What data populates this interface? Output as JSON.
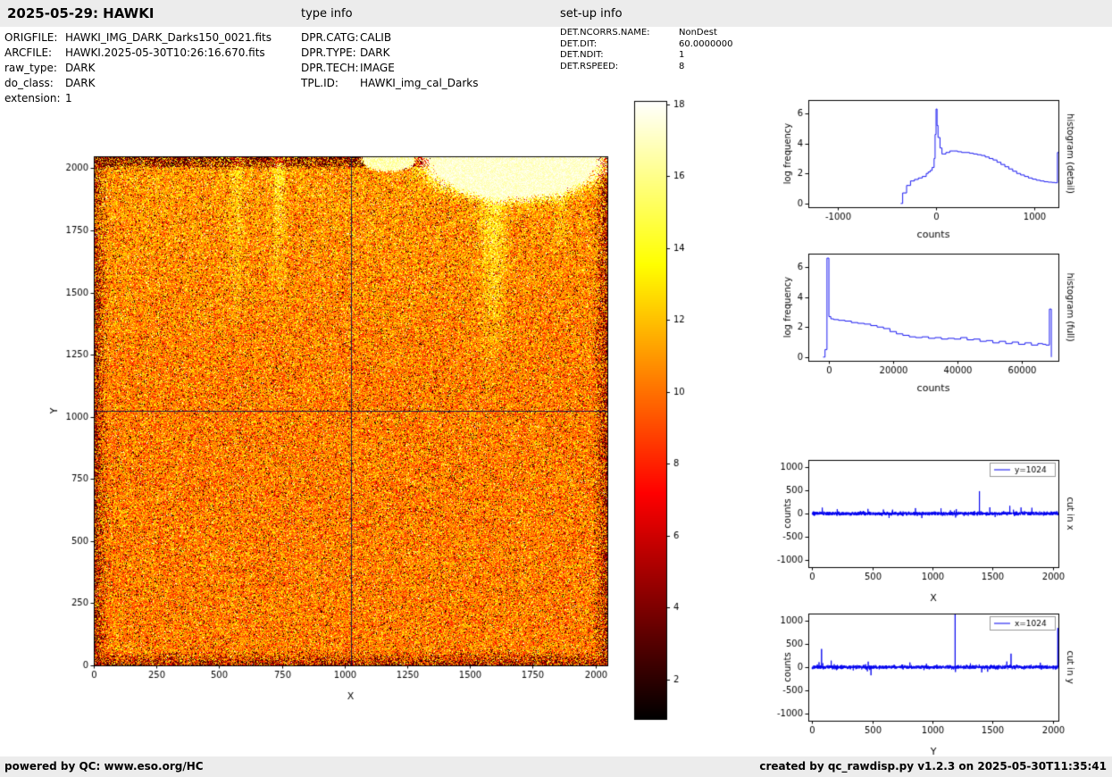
{
  "header": {
    "title": "2025-05-29: HAWKI",
    "type_info_label": "type info",
    "setup_info_label": "set-up info"
  },
  "file_info": {
    "rows": [
      {
        "label": "ORIGFILE:",
        "value": "HAWKI_IMG_DARK_Darks150_0021.fits"
      },
      {
        "label": "ARCFILE:",
        "value": "HAWKI.2025-05-30T10:26:16.670.fits"
      },
      {
        "label": "raw_type:",
        "value": "DARK"
      },
      {
        "label": "do_class:",
        "value": "DARK"
      },
      {
        "label": "extension:",
        "value": "1"
      }
    ]
  },
  "type_info": {
    "rows": [
      {
        "label": "DPR.CATG:",
        "value": "CALIB"
      },
      {
        "label": "DPR.TYPE:",
        "value": "DARK"
      },
      {
        "label": "DPR.TECH:",
        "value": "IMAGE"
      },
      {
        "label": "TPL.ID:",
        "value": "HAWKI_img_cal_Darks"
      }
    ]
  },
  "setup_info": {
    "rows": [
      {
        "label": "DET.NCORRS.NAME:",
        "value": "NonDest"
      },
      {
        "label": "DET.DIT:",
        "value": "60.0000000"
      },
      {
        "label": "DET.NDIT:",
        "value": "1"
      },
      {
        "label": "DET.RSPEED:",
        "value": "8"
      }
    ]
  },
  "footer": {
    "left": "powered by QC: www.eso.org/HC",
    "right": "created by qc_rawdisp.py v1.2.3 on 2025-05-30T11:35:41"
  },
  "colors": {
    "line_blue": "#0000ee",
    "crosshair": "rgba(15,15,70,0.9)",
    "bar_gray": "#ececec"
  },
  "chart_data": [
    {
      "name": "raw_image",
      "type": "heatmap",
      "xlabel": "X",
      "ylabel": "Y",
      "xlim": [
        0,
        2048
      ],
      "ylim": [
        0,
        2048
      ],
      "xticks": [
        0,
        250,
        500,
        750,
        1000,
        1250,
        1500,
        1750,
        2000
      ],
      "yticks": [
        0,
        250,
        500,
        750,
        1000,
        1250,
        1500,
        1750,
        2000
      ],
      "colormap": "hot",
      "crosshair_x": 1024,
      "crosshair_y": 1024,
      "colorbar": {
        "vmin": 0.9,
        "vmax": 18.1,
        "ticks": [
          2,
          4,
          6,
          8,
          10,
          12,
          14,
          16,
          18
        ]
      },
      "description": "2048x2048 dark-frame noise image: red/orange body with black and yellow speckle, dark mottled borders, saturated white blob in top-right corner, faint bright vertical streaks near top"
    },
    {
      "name": "hist_detail",
      "type": "line",
      "style": "step",
      "xlabel": "counts",
      "ylabel": "log frequency",
      "side_label": "histogram (detail)",
      "xlim": [
        -1300,
        1245
      ],
      "ylim": [
        -0.25,
        6.9
      ],
      "xticks": [
        -1000,
        0,
        1000
      ],
      "yticks": [
        0,
        2,
        4,
        6
      ],
      "x": [
        -360,
        -340,
        -300,
        -260,
        -220,
        -180,
        -140,
        -100,
        -80,
        -60,
        -40,
        -20,
        -10,
        0,
        10,
        20,
        40,
        60,
        80,
        100,
        140,
        180,
        220,
        260,
        300,
        340,
        380,
        420,
        460,
        500,
        540,
        580,
        620,
        660,
        700,
        740,
        780,
        820,
        860,
        900,
        940,
        980,
        1020,
        1060,
        1100,
        1140,
        1180,
        1210,
        1235,
        1250
      ],
      "y": [
        0,
        0.7,
        1.2,
        1.5,
        1.6,
        1.7,
        1.8,
        2.0,
        2.1,
        2.2,
        2.4,
        3.0,
        4.6,
        6.3,
        5.2,
        4.4,
        3.7,
        3.3,
        3.3,
        3.4,
        3.5,
        3.5,
        3.45,
        3.4,
        3.4,
        3.35,
        3.3,
        3.25,
        3.2,
        3.1,
        3.0,
        2.9,
        2.75,
        2.6,
        2.45,
        2.3,
        2.15,
        2.0,
        1.9,
        1.8,
        1.7,
        1.62,
        1.55,
        1.5,
        1.45,
        1.42,
        1.4,
        1.38,
        3.4,
        0
      ]
    },
    {
      "name": "hist_full",
      "type": "line",
      "style": "step",
      "xlabel": "counts",
      "ylabel": "log frequency",
      "side_label": "histogram (full)",
      "xlim": [
        -6400,
        71400
      ],
      "ylim": [
        -0.25,
        6.9
      ],
      "xticks": [
        0,
        20000,
        40000,
        60000
      ],
      "yticks": [
        0,
        2,
        4,
        6
      ],
      "x": [
        -1800,
        -1200,
        -600,
        -300,
        0,
        600,
        1500,
        3000,
        5000,
        7000,
        9000,
        11000,
        13000,
        15000,
        17000,
        19000,
        21000,
        23000,
        25000,
        27000,
        29000,
        31000,
        33000,
        35000,
        37000,
        39000,
        41000,
        43000,
        45000,
        47000,
        49000,
        51000,
        53000,
        55000,
        57000,
        59000,
        61000,
        63000,
        65000,
        66500,
        67500,
        68600,
        69200
      ],
      "y": [
        0,
        0.5,
        6.6,
        6.6,
        2.7,
        2.55,
        2.5,
        2.45,
        2.4,
        2.3,
        2.25,
        2.2,
        2.1,
        2.0,
        1.9,
        1.7,
        1.55,
        1.45,
        1.35,
        1.3,
        1.35,
        1.25,
        1.3,
        1.2,
        1.25,
        1.2,
        1.3,
        1.15,
        1.2,
        1.05,
        1.1,
        0.95,
        1.05,
        0.9,
        1.0,
        0.85,
        0.95,
        0.8,
        0.9,
        0.85,
        0.8,
        3.2,
        0
      ]
    },
    {
      "name": "cut_x",
      "type": "line",
      "style": "noise",
      "xlabel": "X",
      "ylabel": "counts",
      "side_label": "cut in x",
      "legend": "y=1024",
      "xlim": [
        -30,
        2045
      ],
      "ylim": [
        -1150,
        1150
      ],
      "xticks": [
        0,
        500,
        1000,
        1500,
        2000
      ],
      "yticks": [
        -1000,
        -500,
        0,
        500,
        1000
      ],
      "n": 2048,
      "noise_sigma": 35,
      "seed": 7,
      "spikes": [
        {
          "x": 210,
          "y": 95
        },
        {
          "x": 640,
          "y": -95
        },
        {
          "x": 1390,
          "y": 480
        },
        {
          "x": 1642,
          "y": 165
        },
        {
          "x": 1735,
          "y": 130
        }
      ]
    },
    {
      "name": "cut_y",
      "type": "line",
      "style": "noise",
      "xlabel": "Y",
      "ylabel": "counts",
      "side_label": "cut in y",
      "legend": "x=1024",
      "xlim": [
        -30,
        2045
      ],
      "ylim": [
        -1150,
        1150
      ],
      "xticks": [
        0,
        500,
        1000,
        1500,
        2000
      ],
      "yticks": [
        -1000,
        -500,
        0,
        500,
        1000
      ],
      "n": 2048,
      "noise_sigma": 35,
      "seed": 13,
      "spikes": [
        {
          "x": 80,
          "y": 390
        },
        {
          "x": 160,
          "y": 140
        },
        {
          "x": 490,
          "y": -175
        },
        {
          "x": 1188,
          "y": 1140
        },
        {
          "x": 1652,
          "y": 290
        },
        {
          "x": 2040,
          "y": 840
        }
      ]
    }
  ]
}
